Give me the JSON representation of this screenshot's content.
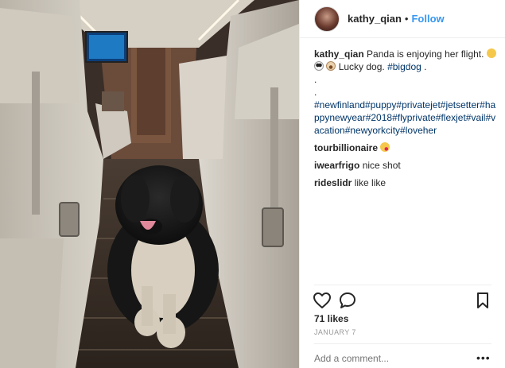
{
  "header": {
    "username": "kathy_qian",
    "separator": "•",
    "follow_label": "Follow"
  },
  "photo": {
    "subject": "newfoundland-dog-in-private-jet"
  },
  "caption": {
    "username": "kathy_qian",
    "text": "Panda is enjoying her flight.",
    "text2": "Lucky dog.",
    "hashtag1": "#bigdog",
    "trail": " .",
    "dot1": ".",
    "dot2": ".",
    "hashtags": "#newfinland#puppy#privatejet#jetsetter#happynewyear#2018#flyprivate#flexjet#vail#vacation#newyorkcity#loveher",
    "emoji1": "smiling-face",
    "emoji2": "panda-face",
    "emoji3": "dog-face"
  },
  "comments": [
    {
      "username": "tourbillionaire",
      "text": "",
      "emoji": "face-blowing-kiss"
    },
    {
      "username": "iwearfrigo",
      "text": "nice shot"
    },
    {
      "username": "rideslidr",
      "text": "like like"
    }
  ],
  "likes": "71 likes",
  "date": "JANUARY 7",
  "add_comment": {
    "placeholder": "Add a comment...",
    "value": ""
  },
  "more_label": "•••",
  "colors": {
    "follow": "#3897f0",
    "hashtag": "#003569",
    "muted": "#999999",
    "text": "#262626"
  }
}
